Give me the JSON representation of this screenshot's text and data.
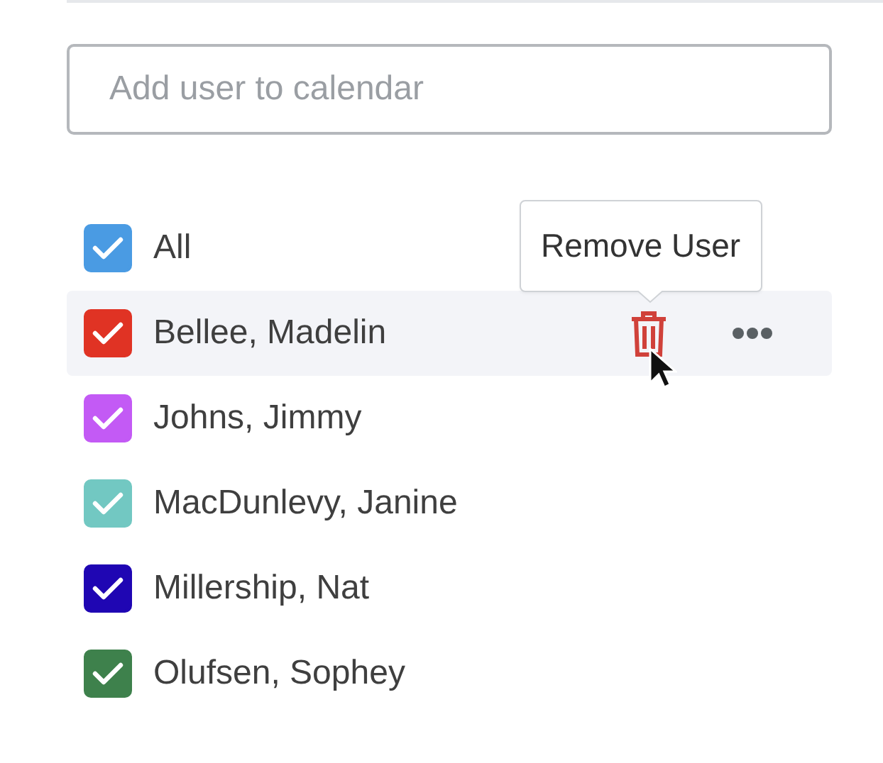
{
  "search": {
    "placeholder": "Add user to calendar"
  },
  "users": [
    {
      "name": "All",
      "checked": true,
      "color": "#4a9be3",
      "hovered": false
    },
    {
      "name": "Bellee, Madelin",
      "checked": true,
      "color": "#e03324",
      "hovered": true,
      "tooltip": "Remove User"
    },
    {
      "name": "Johns, Jimmy",
      "checked": true,
      "color": "#c35af5",
      "hovered": false
    },
    {
      "name": "MacDunlevy, Janine",
      "checked": true,
      "color": "#72c8c2",
      "hovered": false
    },
    {
      "name": "Millership, Nat",
      "checked": true,
      "color": "#1f06b3",
      "hovered": false
    },
    {
      "name": "Olufsen, Sophey",
      "checked": true,
      "color": "#3e814c",
      "hovered": false
    }
  ]
}
